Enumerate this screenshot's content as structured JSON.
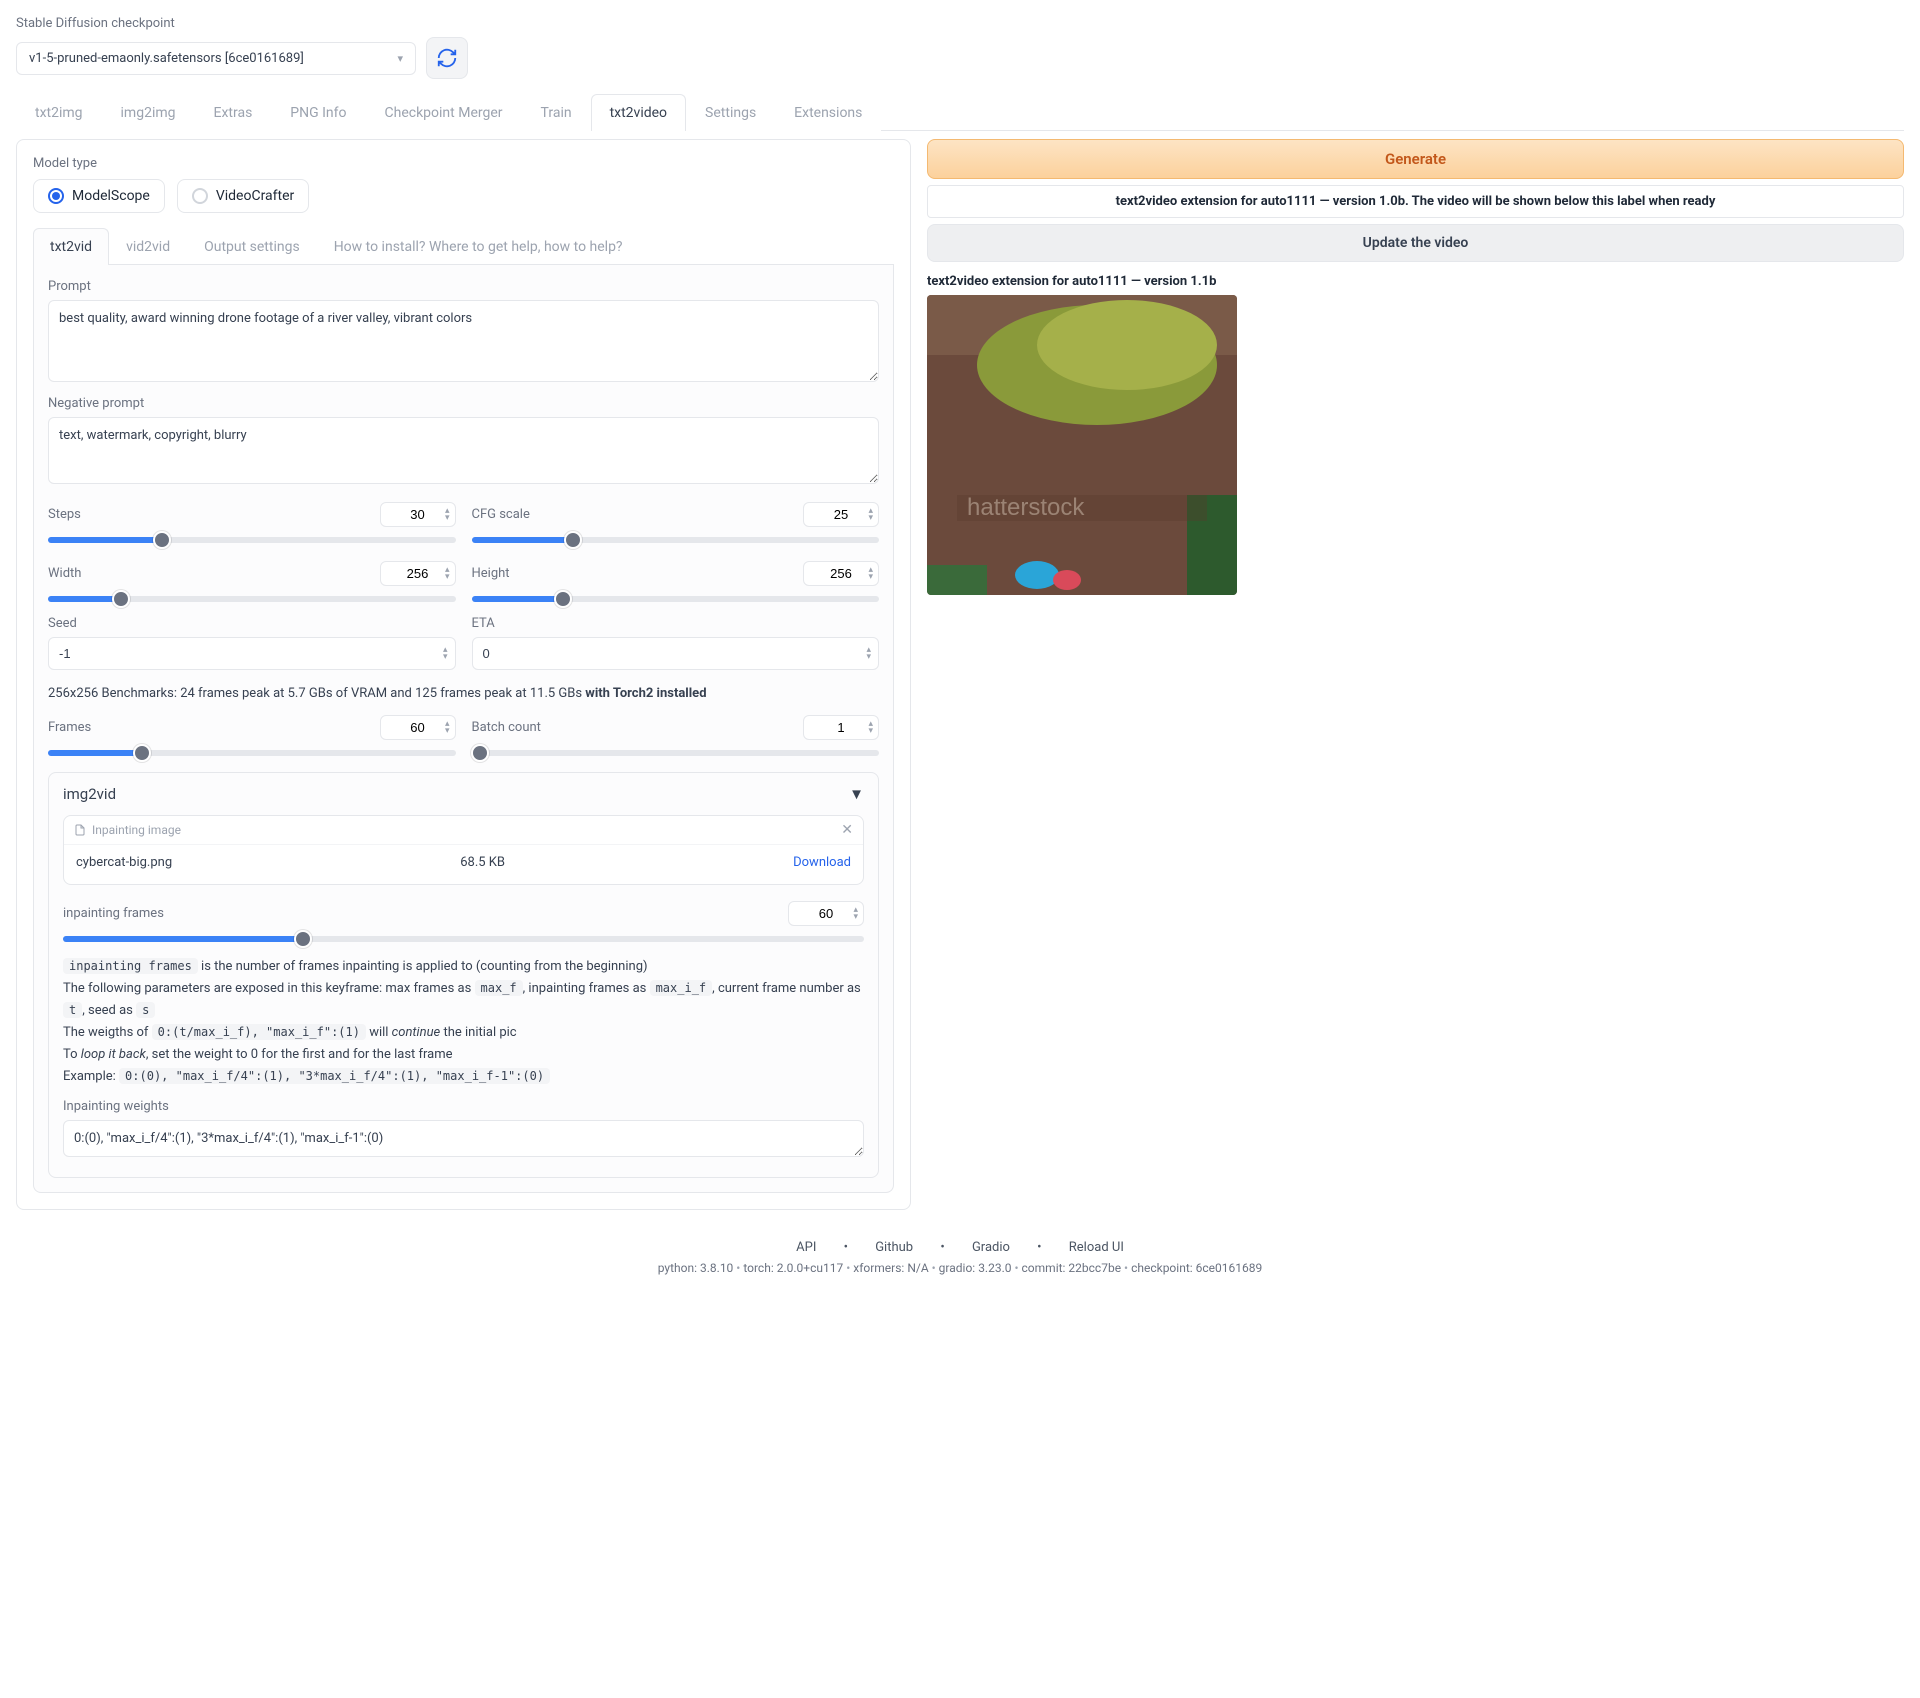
{
  "header": {
    "checkpoint_label": "Stable Diffusion checkpoint",
    "checkpoint_value": "v1-5-pruned-emaonly.safetensors [6ce0161689]"
  },
  "main_tabs": [
    "txt2img",
    "img2img",
    "Extras",
    "PNG Info",
    "Checkpoint Merger",
    "Train",
    "txt2video",
    "Settings",
    "Extensions"
  ],
  "main_tab_active": "txt2video",
  "model_type": {
    "label": "Model type",
    "options": [
      "ModelScope",
      "VideoCrafter"
    ],
    "selected": "ModelScope"
  },
  "sub_tabs": [
    "txt2vid",
    "vid2vid",
    "Output settings",
    "How to install? Where to get help, how to help?"
  ],
  "sub_tab_active": "txt2vid",
  "prompt": {
    "label": "Prompt",
    "value": "best quality, award winning drone footage of a river valley, vibrant colors"
  },
  "neg_prompt": {
    "label": "Negative prompt",
    "value": "text, watermark, copyright, blurry"
  },
  "steps": {
    "label": "Steps",
    "value": 30,
    "pct": 28
  },
  "cfg": {
    "label": "CFG scale",
    "value": 25,
    "pct": 25
  },
  "width": {
    "label": "Width",
    "value": 256,
    "pct": 18
  },
  "height": {
    "label": "Height",
    "value": 256,
    "pct": 22.5
  },
  "seed": {
    "label": "Seed",
    "value": "-1"
  },
  "eta": {
    "label": "ETA",
    "value": "0"
  },
  "benchmark": {
    "text": "256x256 Benchmarks: 24 frames peak at 5.7 GBs of VRAM and 125 frames peak at 11.5 GBs ",
    "bold": "with Torch2 installed"
  },
  "frames": {
    "label": "Frames",
    "value": 60,
    "pct": 23
  },
  "batch": {
    "label": "Batch count",
    "value": 1,
    "pct": 2
  },
  "img2vid": {
    "title": "img2vid",
    "file_section_label": "Inpainting image",
    "file_name": "cybercat-big.png",
    "file_size": "68.5 KB",
    "download": "Download",
    "inpaint_frames": {
      "label": "inpainting frames",
      "value": 60,
      "pct": 30
    },
    "help_lines": {
      "l1a": "inpainting frames",
      "l1b": " is the number of frames inpainting is applied to (counting from the beginning)",
      "l2a": "The following parameters are exposed in this keyframe: max frames as ",
      "l2b": "max_f",
      "l2c": ", inpainting frames as ",
      "l2d": "max_i_f",
      "l2e": ", current frame number as ",
      "l2f": "t",
      "l2g": ", seed as ",
      "l2h": "s",
      "l3a": "The weigths of ",
      "l3b": "0:(t/max_i_f), \"max_i_f\":(1)",
      "l3c": " will ",
      "l3d": "continue",
      "l3e": " the initial pic",
      "l4a": "To ",
      "l4b": "loop it back",
      "l4c": ", set the weight to 0 for the first and for the last frame",
      "l5a": "Example: ",
      "l5b": "0:(0), \"max_i_f/4\":(1), \"3*max_i_f/4\":(1), \"max_i_f-1\":(0)"
    },
    "weights": {
      "label": "Inpainting weights",
      "value": "0:(0), \"max_i_f/4\":(1), \"3*max_i_f/4\":(1), \"max_i_f-1\":(0)"
    }
  },
  "right": {
    "generate": "Generate",
    "info": "text2video extension for auto1111 — version 1.0b. The video will be shown below this label when ready",
    "update": "Update the video",
    "out_label": "text2video extension for auto1111 — version 1.1b"
  },
  "footer": {
    "links": [
      "API",
      "Github",
      "Gradio",
      "Reload UI"
    ],
    "meta": {
      "python_l": "python: ",
      "python": "3.8.10",
      "torch_l": "torch: ",
      "torch": "2.0.0+cu117",
      "xformers_l": "xformers: ",
      "xformers": "N/A",
      "gradio_l": "gradio: ",
      "gradio": "3.23.0",
      "commit_l": "commit: ",
      "commit": "22bcc7be",
      "ckpt_l": "checkpoint: ",
      "ckpt": "6ce0161689"
    }
  }
}
